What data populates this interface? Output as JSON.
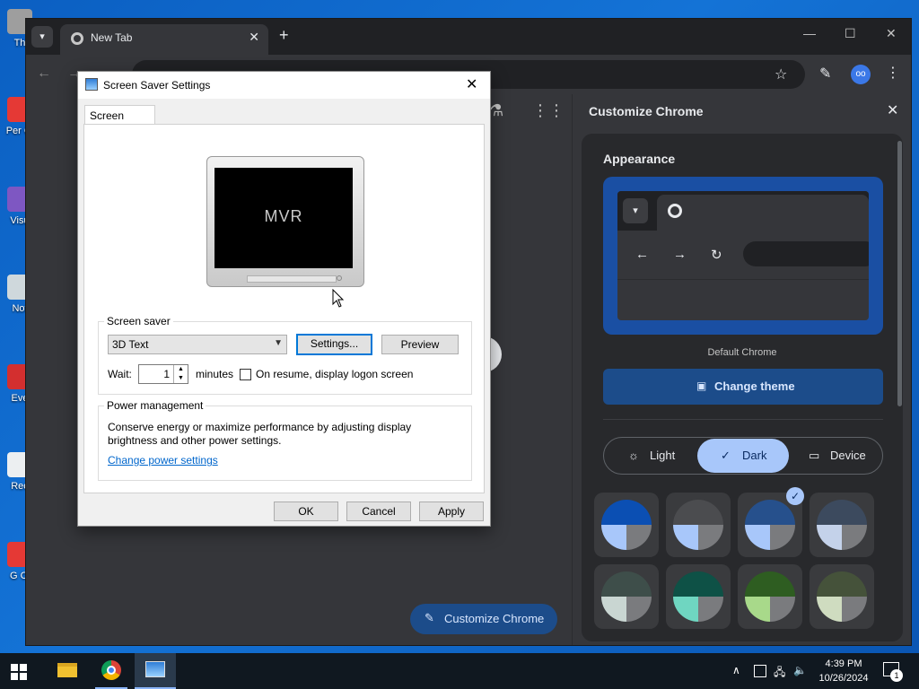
{
  "desktop": {
    "icons": [
      {
        "label": "Th",
        "color": "#9e9e9e"
      },
      {
        "label": "Per Cl",
        "color": "#e53935"
      },
      {
        "label": "Visu",
        "color": "#7e57c2"
      },
      {
        "label": "Not",
        "color": "#cfd8dc"
      },
      {
        "label": "Eve",
        "color": "#d32f2f"
      },
      {
        "label": "Rec",
        "color": "#eceff1"
      },
      {
        "label": "G Cl",
        "color": "#e53935"
      }
    ]
  },
  "chrome": {
    "tab": {
      "title": "New Tab",
      "close": "✕"
    },
    "new_tab": "+",
    "window_controls": {
      "minimize": "—",
      "maximize": "☐",
      "close": "✕"
    },
    "toolbar": {
      "back": "←",
      "forward": "→",
      "star": "☆",
      "pencil": "✎",
      "menu": "⋮",
      "profile": "oo"
    },
    "content": {
      "flask": "⚗",
      "apps": "⋮⋮",
      "customize_button": "Customize Chrome",
      "pencil": "✎"
    }
  },
  "side_panel": {
    "title": "Customize Chrome",
    "close": "✕",
    "appearance": {
      "heading": "Appearance",
      "preview_nav": {
        "back": "←",
        "forward": "→",
        "reload": "↻"
      },
      "theme_name": "Default Chrome",
      "change_theme": "Change theme",
      "change_theme_icon": "▣",
      "modes": [
        {
          "label": "Light",
          "icon": "☼",
          "selected": false
        },
        {
          "label": "Dark",
          "icon": "✓",
          "selected": true
        },
        {
          "label": "Device",
          "icon": "▭",
          "selected": false
        }
      ],
      "swatches": [
        {
          "top": "#0b4fb3",
          "bl": "#a8c7fa",
          "br": "#7a7b7e",
          "selected": false
        },
        {
          "top": "#4b4c4f",
          "bl": "#a8c7fa",
          "br": "#7a7b7e",
          "selected": false
        },
        {
          "top": "#26508c",
          "bl": "#a8c7fa",
          "br": "#7a7b7e",
          "selected": true
        },
        {
          "top": "#3c4a5e",
          "bl": "#c4d2ea",
          "br": "#7a7b7e",
          "selected": false
        },
        {
          "top": "#3e4e4a",
          "bl": "#c9d6d2",
          "br": "#7a7b7e",
          "selected": false
        },
        {
          "top": "#0e5146",
          "bl": "#6fd6c1",
          "br": "#7a7b7e",
          "selected": false
        },
        {
          "top": "#2e5d21",
          "bl": "#a8d98a",
          "br": "#7a7b7e",
          "selected": false
        },
        {
          "top": "#45523a",
          "bl": "#cfdcc0",
          "br": "#7a7b7e",
          "selected": false
        }
      ],
      "check": "✓"
    }
  },
  "dialog": {
    "title": "Screen Saver Settings",
    "close": "✕",
    "tab": "Screen Saver",
    "preview_text": "MVR",
    "screen_saver": {
      "group_label": "Screen saver",
      "selected": "3D Text",
      "settings_button": "Settings...",
      "preview_button": "Preview",
      "wait_label": "Wait:",
      "wait_value": "1",
      "minutes_label": "minutes",
      "resume_label": "On resume, display logon screen",
      "resume_checked": false
    },
    "power": {
      "group_label": "Power management",
      "description": "Conserve energy or maximize performance by adjusting display brightness and other power settings.",
      "link": "Change power settings"
    },
    "buttons": {
      "ok": "OK",
      "cancel": "Cancel",
      "apply": "Apply"
    }
  },
  "taskbar": {
    "time": "4:39 PM",
    "date": "10/26/2024",
    "notification_count": "1",
    "tray": {
      "chevron": "∧",
      "network": "🖧",
      "volume": "🔈"
    }
  }
}
